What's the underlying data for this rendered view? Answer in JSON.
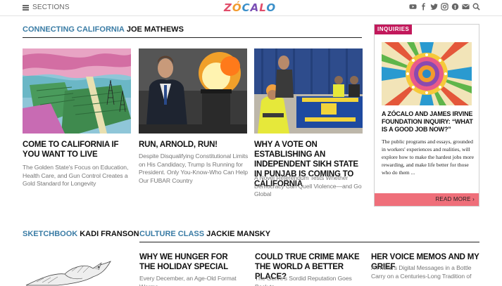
{
  "header": {
    "sections_label": "SECTIONS",
    "logo_text": "ZÓCALO",
    "social_icons": [
      "youtube-icon",
      "facebook-icon",
      "twitter-icon",
      "instagram-icon",
      "podcast-icon",
      "email-icon",
      "search-icon"
    ]
  },
  "connecting": {
    "label": "CONNECTING CALIFORNIA",
    "author": "JOE MATHEWS",
    "cards": [
      {
        "title": "COME TO CALIFORNIA IF YOU WANT TO LIVE",
        "dek": "The Golden State's Focus on Education, Health Care, and Gun Control Creates a Gold Standard for Longevity"
      },
      {
        "title": "RUN, ARNOLD, RUN!",
        "dek": "Despite Disqualifying Constitutional Limits on His Candidacy, Trump Is Running for President. Only You-Know-Who Can Help Our FUBAR Country"
      },
      {
        "title": "WHY A VOTE ON ESTABLISHING AN INDEPENDENT SIKH STATE IN PUNJAB IS COMING TO CALIFORNIA",
        "dek": "A Novel Referendum Tests Whether Democracy Can Quell Violence—and Go Global"
      }
    ]
  },
  "inquiries": {
    "tag": "INQUIRIES",
    "title": "A ZÓCALO AND JAMES IRVINE FOUNDATION INQUIRY: “WHAT IS A GOOD JOB NOW?”",
    "body": "The public programs and essays, grounded in workers' experiences and realities, will explore how to make the hardest jobs more rewarding, and make life better for those who do them ...",
    "read_more": "READ MORE"
  },
  "sketchbook": {
    "label": "SKETCHBOOK",
    "author": "KADI FRANSON"
  },
  "culture": {
    "label": "CULTURE CLASS",
    "author": "JACKIE MANSKY",
    "cards": [
      {
        "title": "WHY WE HUNGER FOR THE HOLIDAY SPECIAL",
        "dek": "Every December, an Age-Old Format Worms"
      },
      {
        "title": "COULD TRUE CRIME MAKE THE WORLD A BETTER PLACE?",
        "dek": "The Genre's Sordid Reputation Goes Back to"
      },
      {
        "title": "HER VOICE MEMOS AND MY GRIEF",
        "dek": "A Friend's Digital Messages in a Bottle Carry on a Centuries-Long Tradition of"
      }
    ]
  },
  "colors": {
    "section_label": "#3a7ca5",
    "inquiry_tag": "#c2185b",
    "read_more_bg": "#ef6f7a"
  }
}
